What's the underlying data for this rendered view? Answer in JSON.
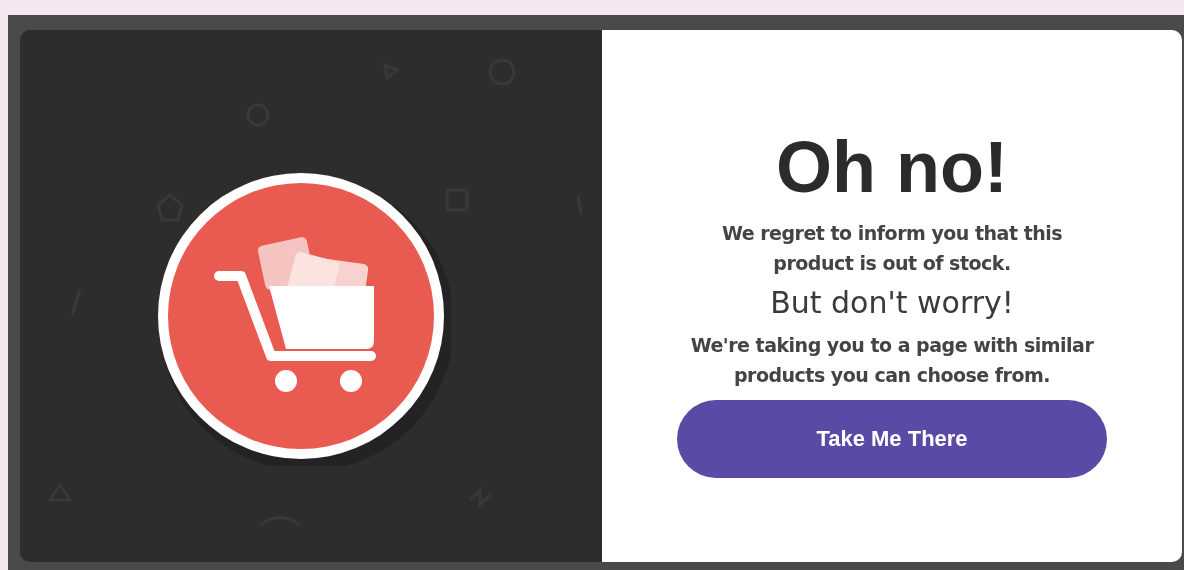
{
  "title": "Oh no!",
  "message_lines": [
    "We regret to inform you that this",
    "product is out of stock."
  ],
  "subtitle": "But don't worry!",
  "detail_lines": [
    "We're taking you to a page with similar",
    "products you can choose from."
  ],
  "button": {
    "label": "Take Me There"
  }
}
